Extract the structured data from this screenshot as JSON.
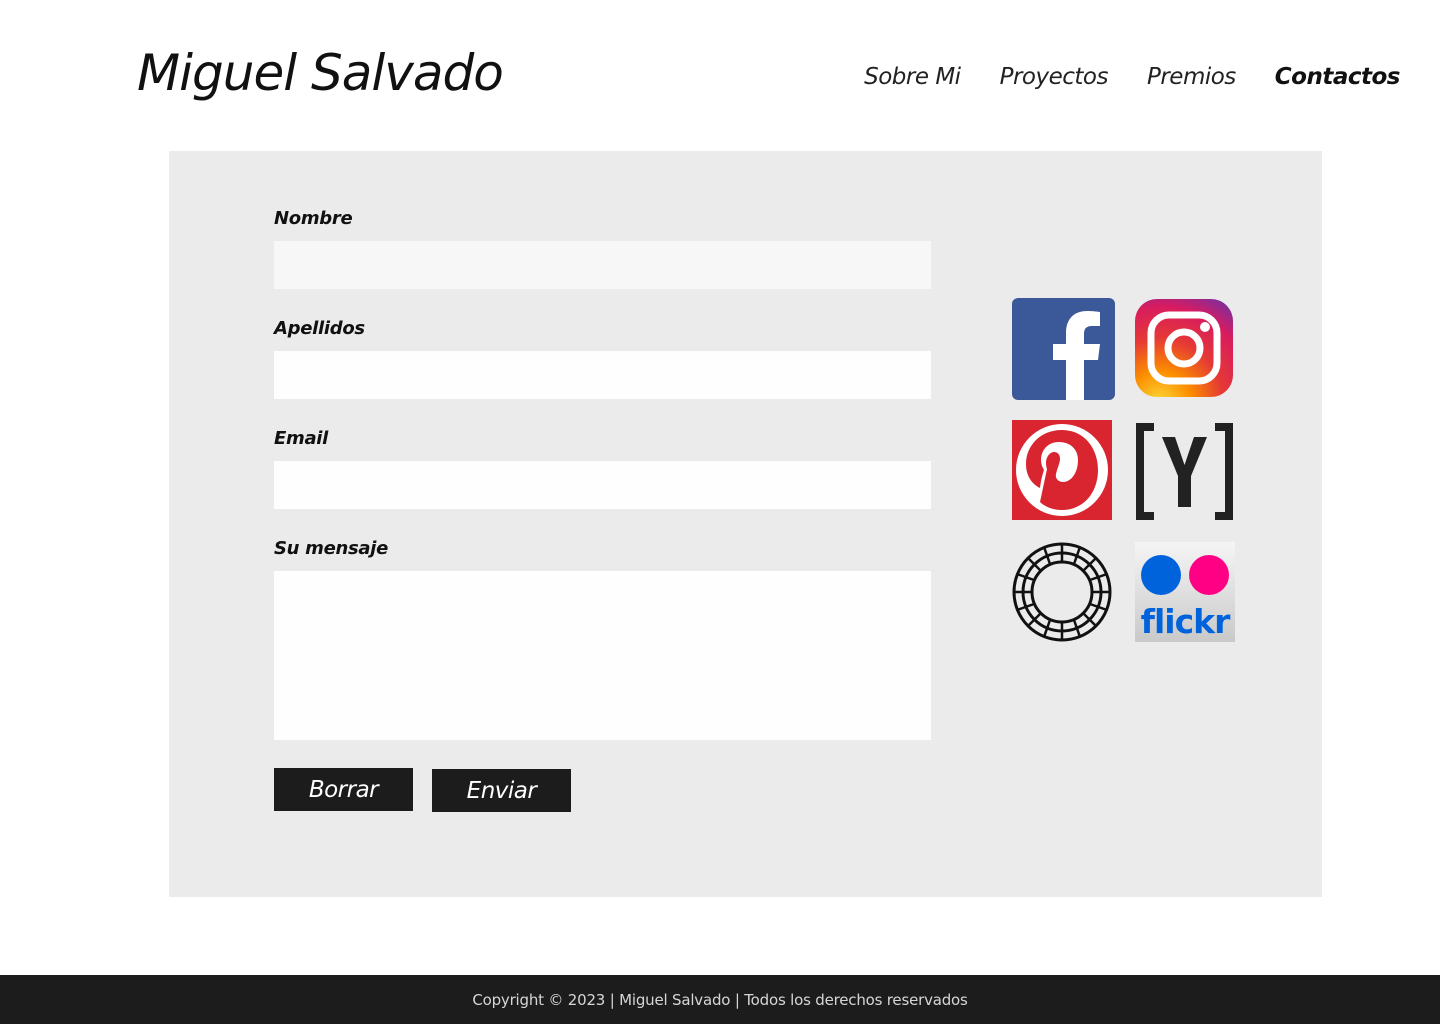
{
  "header": {
    "site_title": "Miguel Salvado",
    "nav": [
      {
        "label": "Sobre Mi",
        "active": false
      },
      {
        "label": "Proyectos",
        "active": false
      },
      {
        "label": "Premios",
        "active": false
      },
      {
        "label": "Contactos",
        "active": true
      }
    ]
  },
  "form": {
    "nombre_label": "Nombre",
    "nombre_value": "",
    "apellidos_label": "Apellidos",
    "apellidos_value": "",
    "email_label": "Email",
    "email_value": "",
    "mensaje_label": "Su mensaje",
    "mensaje_value": "",
    "reset_label": "Borrar",
    "submit_label": "Enviar"
  },
  "social": {
    "icons": [
      "facebook-icon",
      "instagram-icon",
      "pinterest-icon",
      "ycombinator-icon",
      "vsco-icon",
      "flickr-icon"
    ],
    "flickr_text": "flickr"
  },
  "colors": {
    "panel_bg": "#ebebeb",
    "button_bg": "#1c1c1c",
    "footer_bg": "#1c1c1c",
    "facebook": "#3b5998",
    "pinterest": "#e60023",
    "flickr_blue": "#0063dc",
    "flickr_pink": "#ff0084"
  },
  "footer": {
    "text": "Copyright © 2023 | Miguel Salvado | Todos los derechos reservados"
  }
}
